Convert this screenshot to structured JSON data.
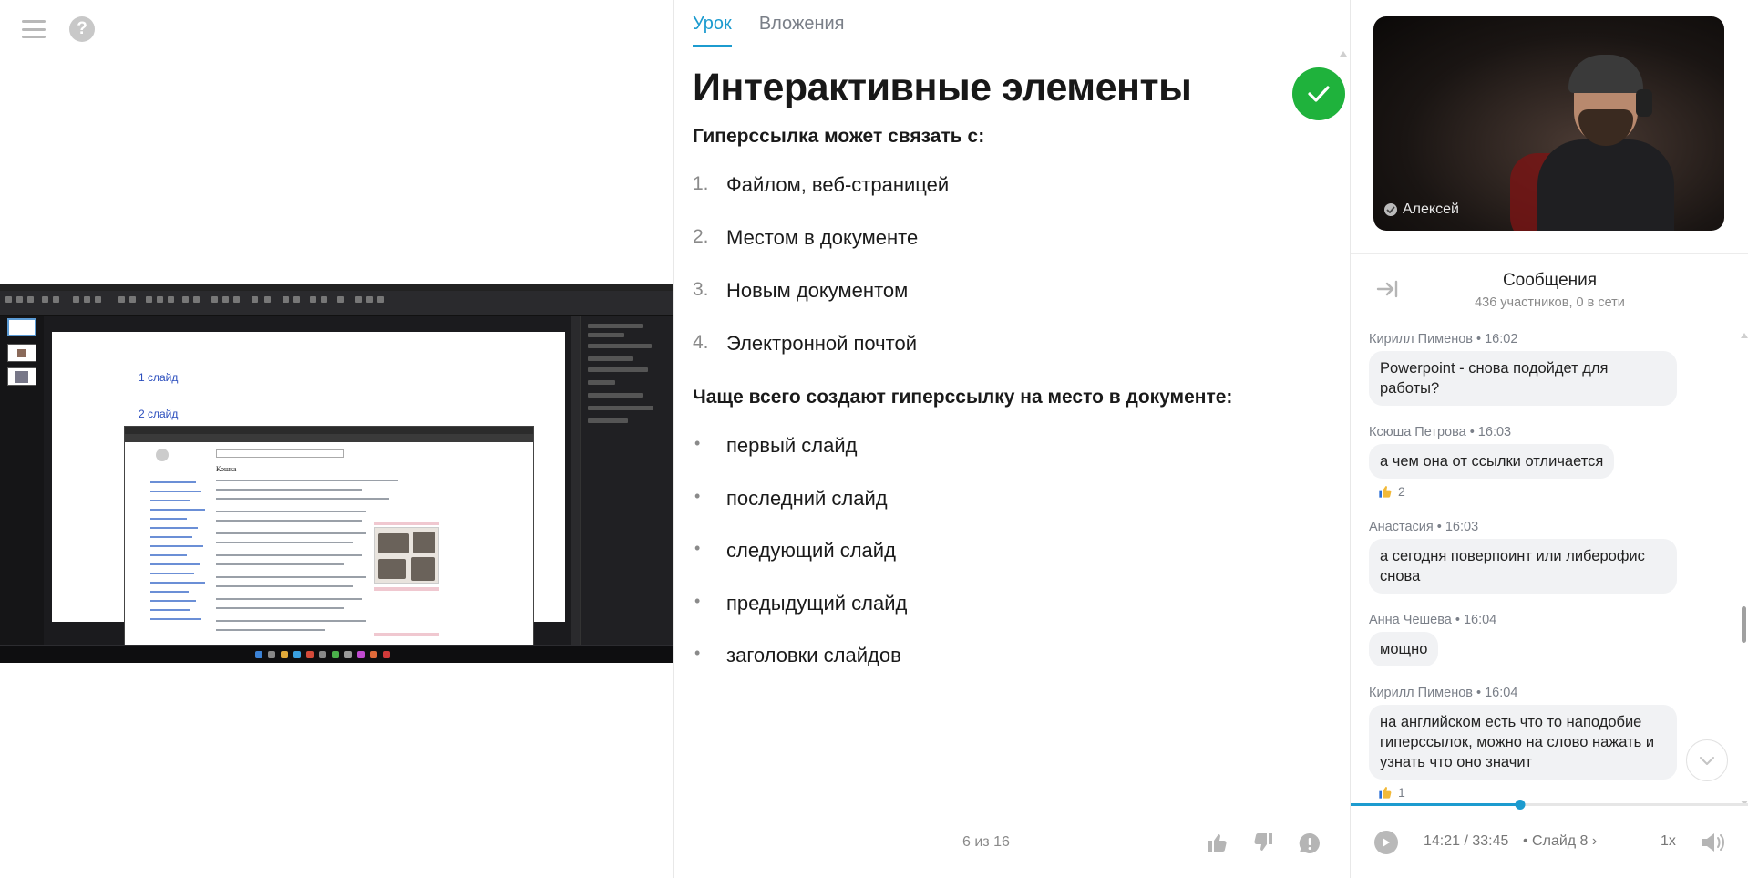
{
  "nav": {
    "menu_icon": "menu-icon",
    "help_icon": "help-icon",
    "help_glyph": "?"
  },
  "screen_share": {
    "slide_links": [
      "1 слайд",
      "2 слайд"
    ],
    "browser_article_title": "Кошка"
  },
  "tabs": [
    {
      "label": "Урок",
      "active": true
    },
    {
      "label": "Вложения",
      "active": false
    }
  ],
  "lesson": {
    "title": "Интерактивные элементы",
    "completed": true,
    "subtitle1": "Гиперссылка может связать с:",
    "ordered_items": [
      {
        "num": "1.",
        "text": "Файлом, веб-страницей"
      },
      {
        "num": "2.",
        "text": "Местом в документе"
      },
      {
        "num": "3.",
        "text": "Новым документом"
      },
      {
        "num": "4.",
        "text": "Электронной почтой"
      }
    ],
    "subtitle2": "Чаще всего создают гиперссылку на место в документе:",
    "bullet_items": [
      "первый слайд",
      "последний слайд",
      "следующий слайд",
      "предыдущий слайд",
      "заголовки слайдов"
    ],
    "bullet_glyph": "•",
    "counter": "6 из 16"
  },
  "feedback": {
    "like_icon": "thumbs-up-icon",
    "dislike_icon": "thumbs-down-icon",
    "report_icon": "report-icon"
  },
  "video": {
    "speaker_name": "Алексей"
  },
  "messages": {
    "title": "Сообщения",
    "subtitle": "436 участников, 0 в сети",
    "items": [
      {
        "author": "Кирилл Пименов • 16:02",
        "text": "Powerpoint - снова подойдет для работы?",
        "reaction": ""
      },
      {
        "author": "Ксюша Петрова • 16:03",
        "text": "а чем она от ссылки отличается",
        "reaction": "2"
      },
      {
        "author": "Анастасия • 16:03",
        "text": "а сегодня поверпоинт или либерофис снова",
        "reaction": ""
      },
      {
        "author": "Анна Чешева • 16:04",
        "text": "мощно",
        "reaction": ""
      },
      {
        "author": "Кирилл Пименов • 16:04",
        "text": "на английском есть что то наподобие гиперссылок, можно на слово нажать и узнать что оно значит",
        "reaction": "1"
      }
    ]
  },
  "player": {
    "time": "14:21 / 33:45",
    "slide_link": "• Слайд 8 ›",
    "speed": "1x",
    "progress": 0.425
  },
  "colors": {
    "accent": "#1c9bcf",
    "success": "#1fb23c"
  }
}
